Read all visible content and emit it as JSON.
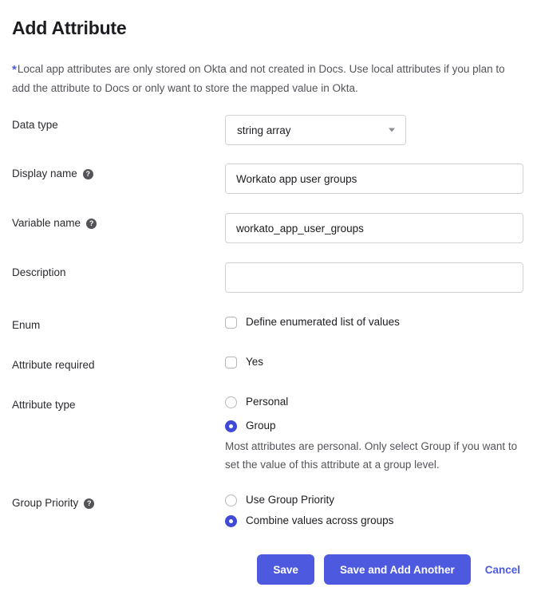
{
  "page": {
    "title": "Add Attribute",
    "note_asterisk": "*",
    "note_text": "Local app attributes are only stored on Okta and not created in Docs. Use local attributes if you plan to add the attribute to Docs or only want to store the mapped value in Okta."
  },
  "colors": {
    "accent": "#4d5ae0",
    "radio_selected": "#3f4ad6",
    "border": "#d2d2d6",
    "label_text": "#2b2b30",
    "muted_text": "#54545a"
  },
  "icons": {
    "help": "?",
    "chevron_down": "caret-down-icon"
  },
  "fields": {
    "data_type": {
      "label": "Data type",
      "value": "string array"
    },
    "display_name": {
      "label": "Display name",
      "value": "Workato app user groups",
      "placeholder": "",
      "has_help": true
    },
    "variable_name": {
      "label": "Variable name",
      "value": "workato_app_user_groups",
      "placeholder": "",
      "has_help": true
    },
    "description": {
      "label": "Description",
      "value": "",
      "placeholder": "",
      "has_help": false
    },
    "enum": {
      "label": "Enum",
      "option_label": "Define enumerated list of values",
      "checked": false
    },
    "attribute_required": {
      "label": "Attribute required",
      "option_label": "Yes",
      "checked": false
    },
    "attribute_type": {
      "label": "Attribute type",
      "options": [
        {
          "label": "Personal",
          "selected": false
        },
        {
          "label": "Group",
          "selected": true
        }
      ],
      "help_text": "Most attributes are personal. Only select Group if you want to set the value of this attribute at a group level."
    },
    "group_priority": {
      "label": "Group Priority",
      "has_help": true,
      "options": [
        {
          "label": "Use Group Priority",
          "selected": false
        },
        {
          "label": "Combine values across groups",
          "selected": true
        }
      ]
    }
  },
  "footer": {
    "save_label": "Save",
    "save_add_another_label": "Save and Add Another",
    "cancel_label": "Cancel"
  }
}
